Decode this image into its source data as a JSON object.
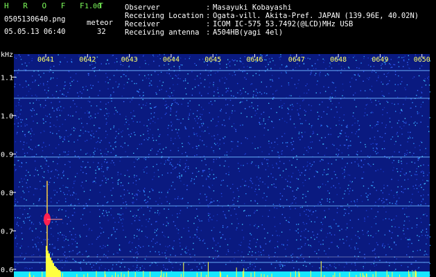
{
  "header": {
    "app_name": "H R O F F T",
    "version": "1.00",
    "filename": "0505130640.png",
    "datetime": "05.05.13 06:40",
    "meteor_label": "meteor",
    "meteor_count": "32"
  },
  "info": [
    {
      "label": "Observer",
      "value": "Masayuki Kobayashi"
    },
    {
      "label": "Receiving Location",
      "value": "Ogata-vill. Akita-Pref. JAPAN (139.96E, 40.02N)"
    },
    {
      "label": "Receiver",
      "value": "ICOM IC-575 53.7492(@LCD)MHz USB"
    },
    {
      "label": "Receiving antenna",
      "value": "A504HB(yagi 4el)"
    }
  ],
  "colors": {
    "background": "#000000",
    "plot_background": "#0a1a80",
    "time_label": "#ffff66",
    "title_green": "#7cfc5a",
    "echo_red": "#ff2050",
    "baseline": "#18e6ff",
    "power_bars": "#ffff40"
  },
  "chart_data": {
    "type": "heatmap",
    "title": "",
    "xlabel": "",
    "ylabel": "kHz",
    "x_ticks": [
      "0641",
      "0642",
      "0643",
      "0644",
      "0645",
      "0646",
      "0647",
      "0648",
      "0649",
      "0650"
    ],
    "x_range": [
      "0640",
      "0650"
    ],
    "y_ticks": [
      0.6,
      0.7,
      0.8,
      0.9,
      1.0,
      1.1
    ],
    "ylim": [
      0.58,
      1.16
    ],
    "y_unit_label": "kHz",
    "carrier_lines_khz": [
      1.117,
      1.045,
      0.892,
      0.765,
      0.618
    ],
    "meteor_echo": {
      "time": "06:40.5",
      "center_khz": 0.73,
      "span_khz": [
        0.64,
        0.83
      ]
    },
    "meteor_count": 32
  }
}
